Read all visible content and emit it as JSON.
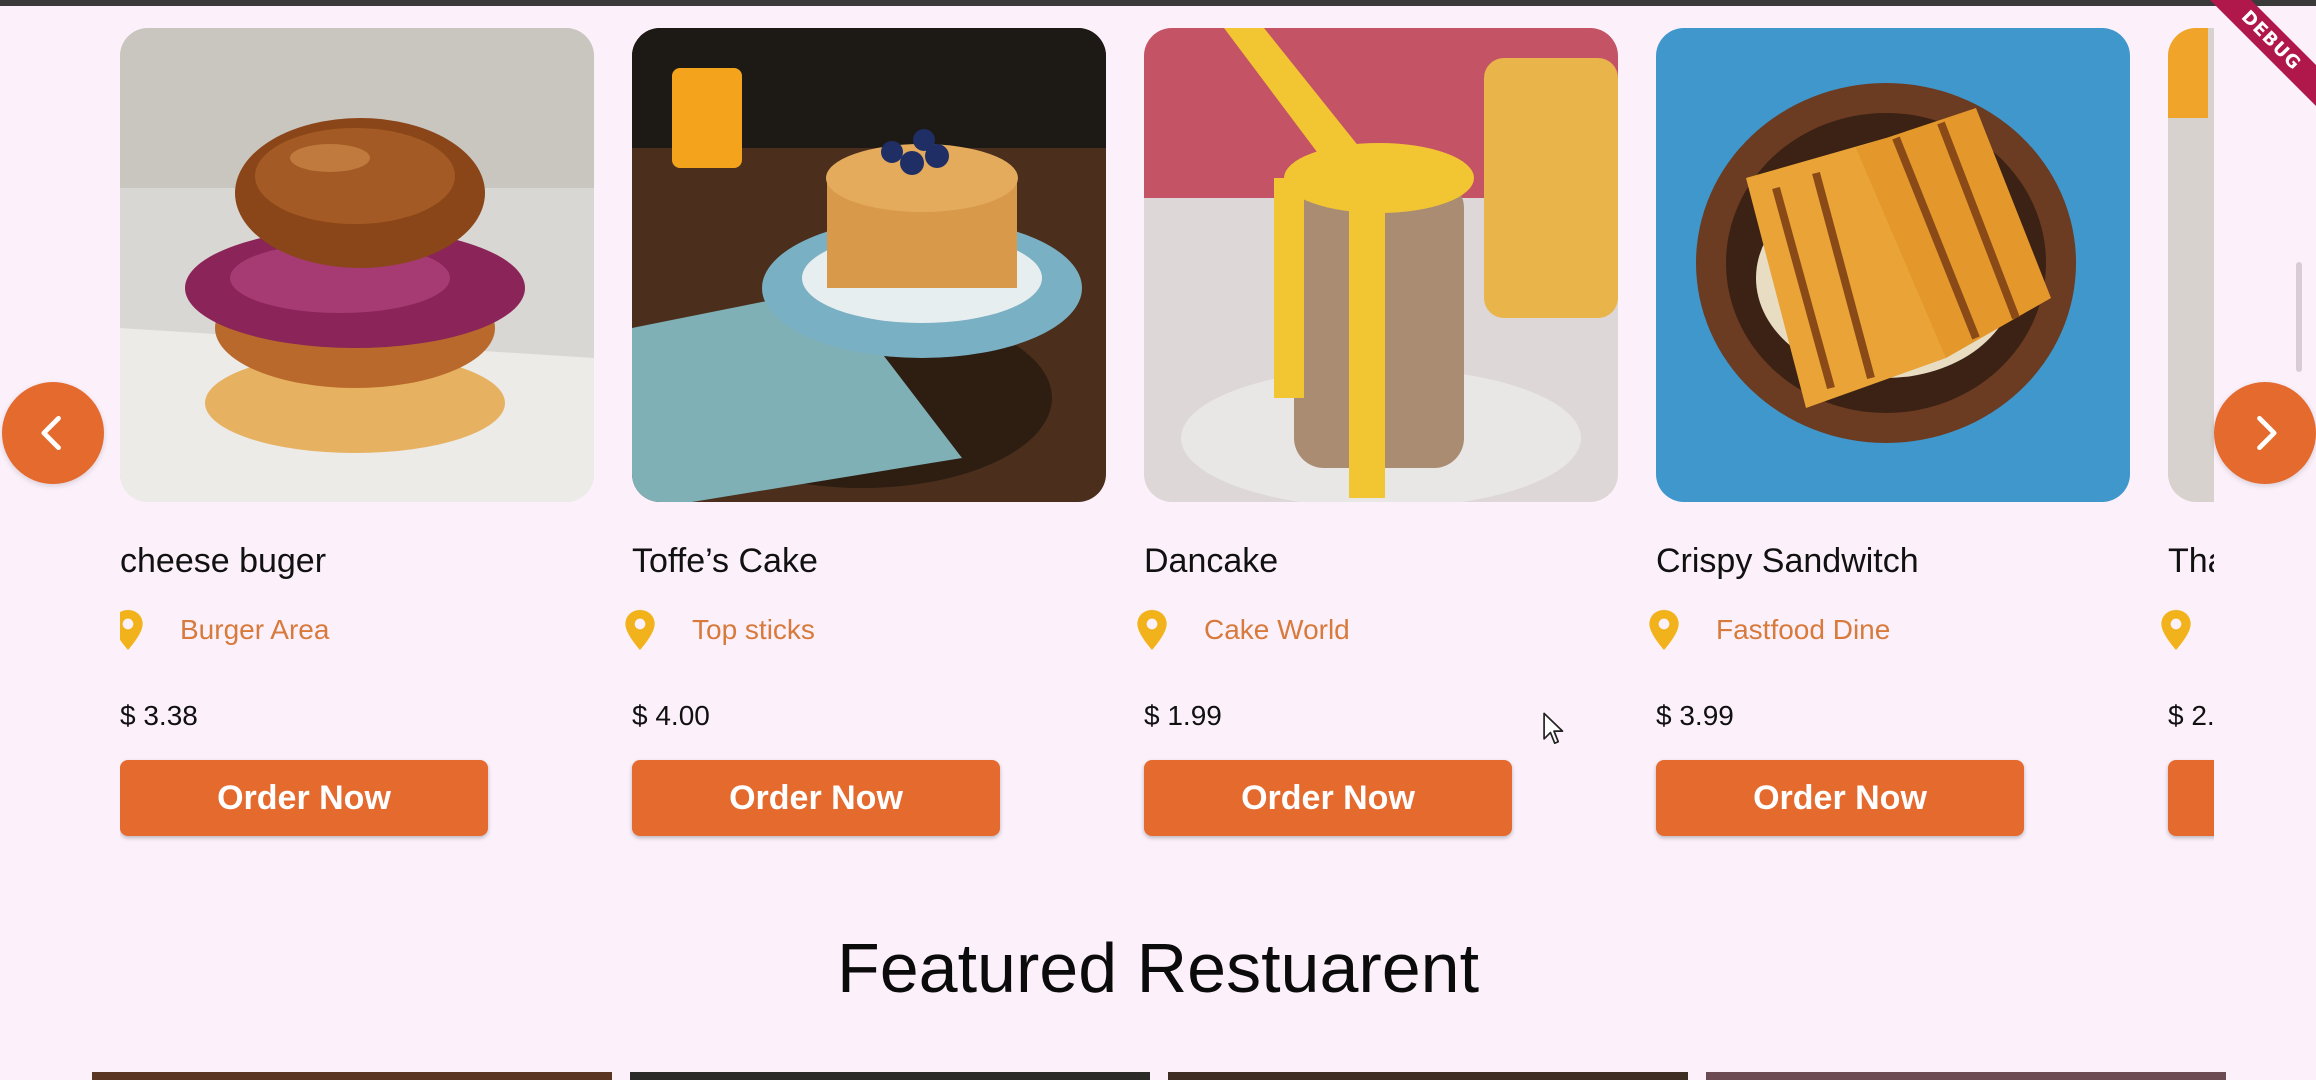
{
  "debug_banner": "DEBUG",
  "carousel": {
    "prev_icon": "chevron-left-icon",
    "next_icon": "chevron-right-icon",
    "cards": [
      {
        "title": "cheese buger",
        "location": "Burger Area",
        "price": "$ 3.38",
        "button": "Order Now"
      },
      {
        "title": "Toffe’s Cake",
        "location": "Top sticks",
        "price": "$ 4.00",
        "button": "Order Now"
      },
      {
        "title": "Dancake",
        "location": "Cake World",
        "price": "$ 1.99",
        "button": "Order Now"
      },
      {
        "title": "Crispy Sandwitch",
        "location": "Fastfood Dine",
        "price": "$ 3.99",
        "button": "Order Now"
      },
      {
        "title": "Tha",
        "location": "",
        "price": "$ 2.",
        "button": ""
      }
    ]
  },
  "featured": {
    "title": "Featured Restuarent"
  },
  "colors": {
    "accent": "#e46a2e",
    "location_text": "#d77a3b",
    "pin": "#f2b21c",
    "background": "#fcf1fb"
  }
}
